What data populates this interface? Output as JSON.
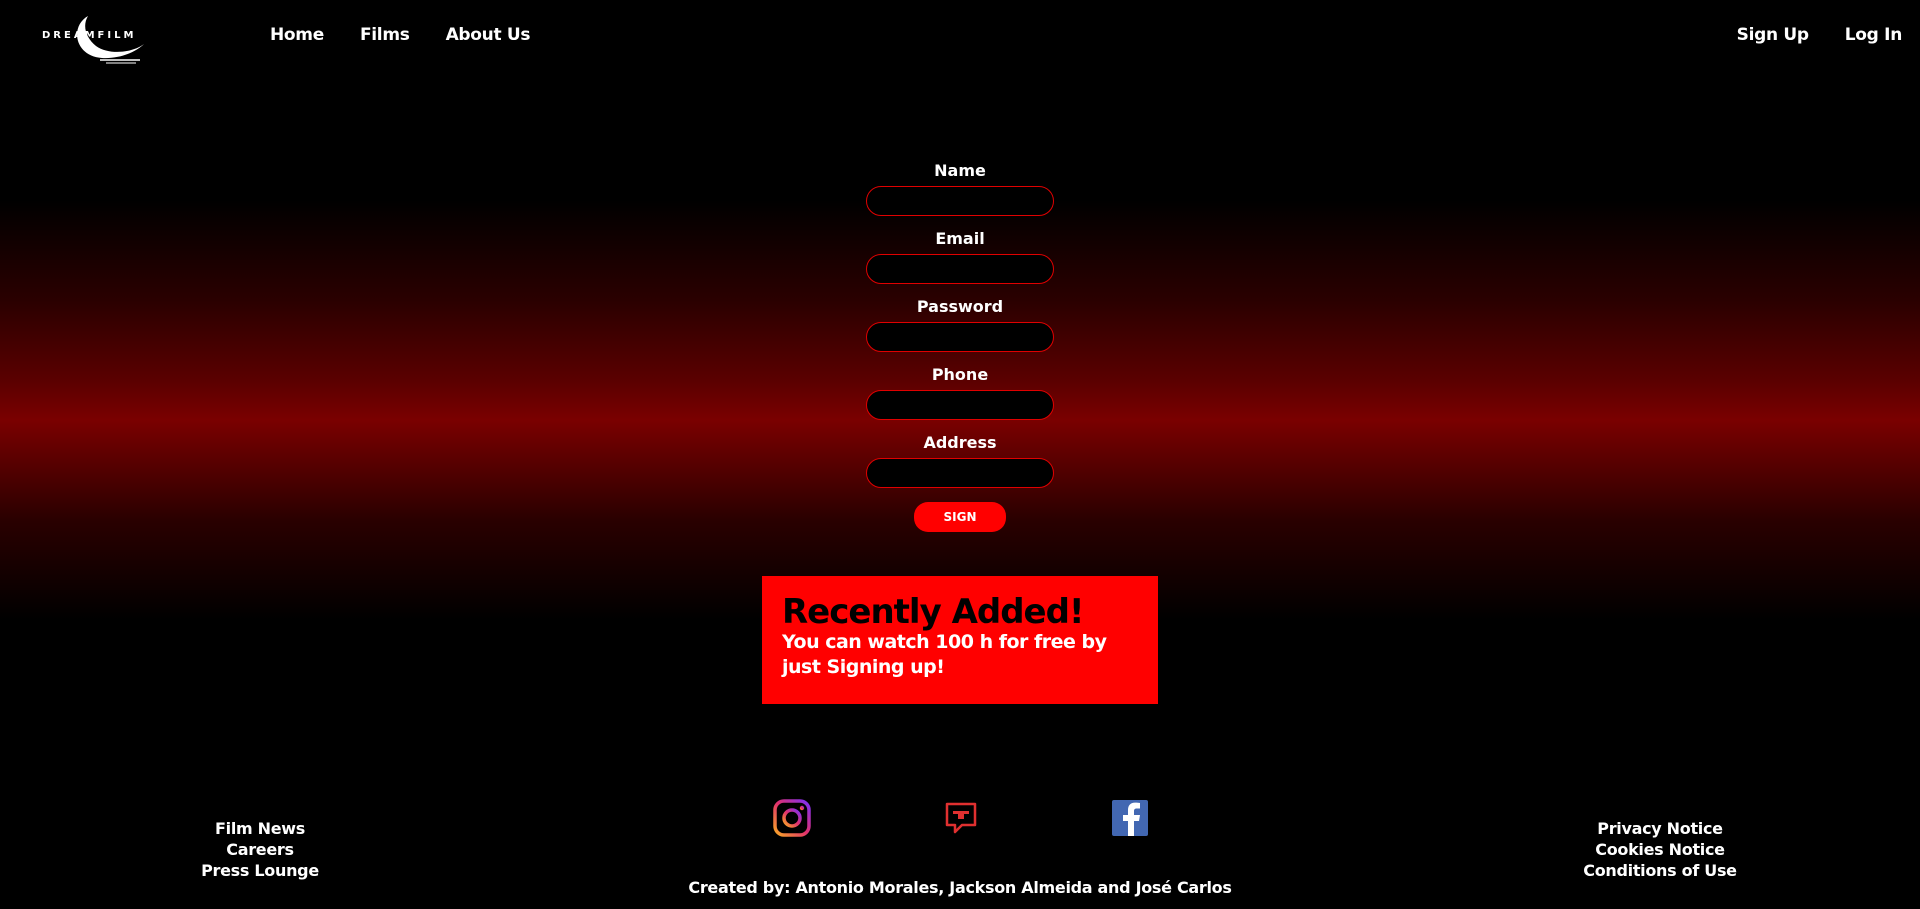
{
  "header": {
    "logo_text": "DREAMFILM",
    "nav": {
      "home": "Home",
      "films": "Films",
      "about": "About Us"
    },
    "auth": {
      "signup": "Sign Up",
      "login": "Log In"
    }
  },
  "form": {
    "name_label": "Name",
    "email_label": "Email",
    "password_label": "Password",
    "phone_label": "Phone",
    "address_label": "Address",
    "submit_label": "SIGN"
  },
  "banner": {
    "title": "Recently Added!",
    "text": "You can watch 100 h for free by just Signing up!"
  },
  "footer": {
    "left_links": {
      "film_news": "Film News",
      "careers": "Careers",
      "press_lounge": "Press Lounge"
    },
    "right_links": {
      "privacy": "Privacy Notice",
      "cookies": "Cookies Notice",
      "conditions": "Conditions of Use"
    },
    "credits": "Created by: Antonio Morales, Jackson Almeida and José Carlos",
    "social_icons": [
      "instagram-icon",
      "chat-icon",
      "facebook-icon"
    ]
  },
  "colors": {
    "accent": "#ff0000",
    "background": "#000000",
    "glow": "#7a0000"
  }
}
